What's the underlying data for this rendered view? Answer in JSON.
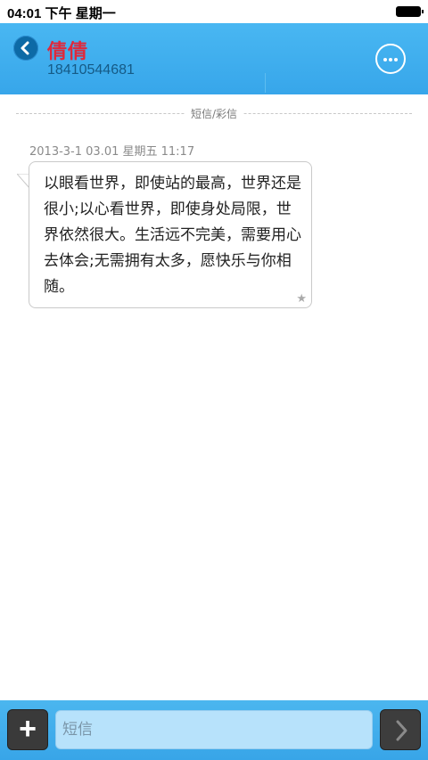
{
  "status_bar": {
    "time": "04:01 下午 星期一"
  },
  "header": {
    "contact_name": "倩倩",
    "contact_number": "18410544681"
  },
  "separator": {
    "label": "短信/彩信"
  },
  "messages": [
    {
      "timestamp": "2013-3-1 03.01 星期五  11:17",
      "text": "以眼看世界，即使站的最高，世界还是很小;以心看世界，即使身处局限，世界依然很大。生活远不完美，需要用心去体会;无需拥有太多，愿快乐与你相随。"
    }
  ],
  "bottom_bar": {
    "add_label": "+",
    "input_placeholder": "短信"
  },
  "colors": {
    "header_blue": "#3fb0ef",
    "contact_name_red": "#e0283a",
    "contact_number_blue": "#155a86",
    "back_button_blue": "#0d6aa6"
  },
  "icons": [
    "back-icon",
    "more-icon",
    "star-icon",
    "add-icon",
    "send-arrow-icon",
    "battery-icon"
  ]
}
